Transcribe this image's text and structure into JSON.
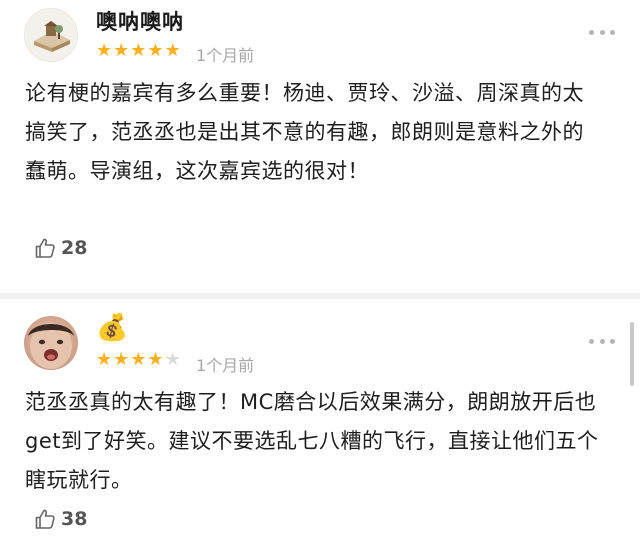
{
  "reviews": [
    {
      "username": "噢呐噢呐",
      "badge": "",
      "rating": 5,
      "time": "1个月前",
      "content": "论有梗的嘉宾有多么重要！杨迪、贾玲、沙溢、周深真的太搞笑了，范丞丞也是出其不意的有趣，郎朗则是意料之外的蠢萌。导演组，这次嘉宾选的很对！",
      "likes": "28"
    },
    {
      "username": "",
      "badge": "💰",
      "rating": 4,
      "time": "1个月前",
      "content": "范丞丞真的太有趣了！MC磨合以后效果满分，朗朗放开后也get到了好笑。建议不要选乱七八糟的飞行，直接让他们五个瞎玩就行。",
      "likes": "38"
    }
  ],
  "icons": {
    "star": "★",
    "more": "more-dots-icon",
    "like": "thumbs-up-icon",
    "badge": "money-bag-icon"
  },
  "colors": {
    "star_filled": "#ffb01e",
    "star_empty": "#dadada",
    "meta_text": "#a8a8a8",
    "divider": "#f2f2f2"
  }
}
